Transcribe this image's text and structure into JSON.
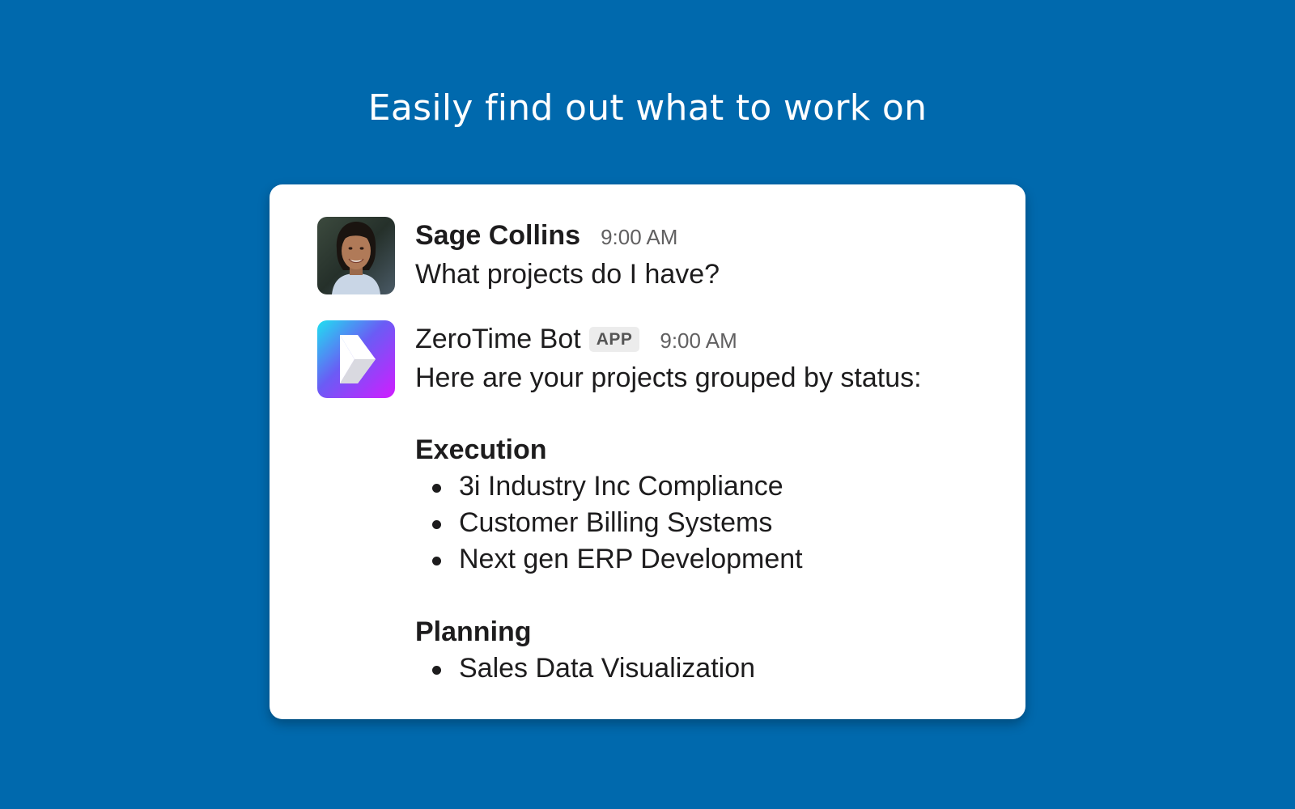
{
  "headline": "Easily find out what to work on",
  "messages": [
    {
      "avatar": "user-photo",
      "sender": "Sage Collins",
      "time": "9:00 AM",
      "text": "What projects do I have?"
    },
    {
      "avatar": "zerotime-logo-icon",
      "sender": "ZeroTime Bot",
      "badge": "APP",
      "time": "9:00 AM",
      "text": "Here are your projects grouped by status:",
      "groups": [
        {
          "heading": "Execution",
          "items": [
            "3i Industry Inc Compliance",
            "Customer Billing Systems",
            "Next gen ERP Development"
          ]
        },
        {
          "heading": "Planning",
          "items": [
            "Sales Data Visualization"
          ]
        }
      ]
    }
  ],
  "colors": {
    "background": "#0069ad",
    "card": "#ffffff",
    "text": "#1d1c1d",
    "timestamp": "#616061",
    "badge_bg": "#ececec",
    "bot_gradient_start": "#1fe0f0",
    "bot_gradient_end": "#d11cff"
  }
}
